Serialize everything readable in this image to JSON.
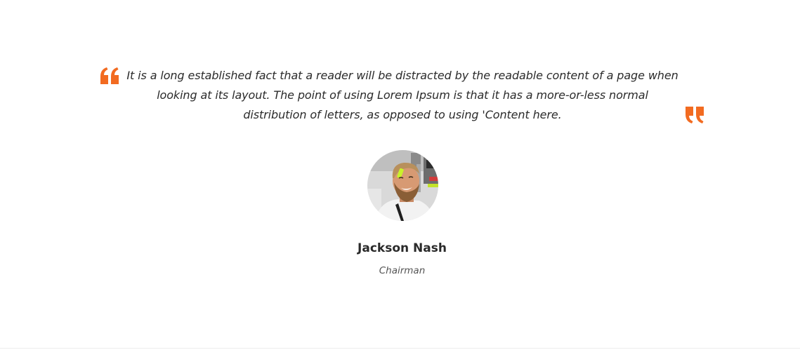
{
  "testimonial": {
    "quote": "It is a long established fact that a reader will be distracted by the readable content of a page when looking at its layout. The point of using Lorem Ipsum is that it has a more-or-less normal distribution of letters, as opposed to using 'Content here.",
    "name": "Jackson Nash",
    "role": "Chairman",
    "open_quote_icon": "quote-open-icon",
    "close_quote_icon": "quote-close-icon",
    "accent_color": "#f26b21"
  }
}
